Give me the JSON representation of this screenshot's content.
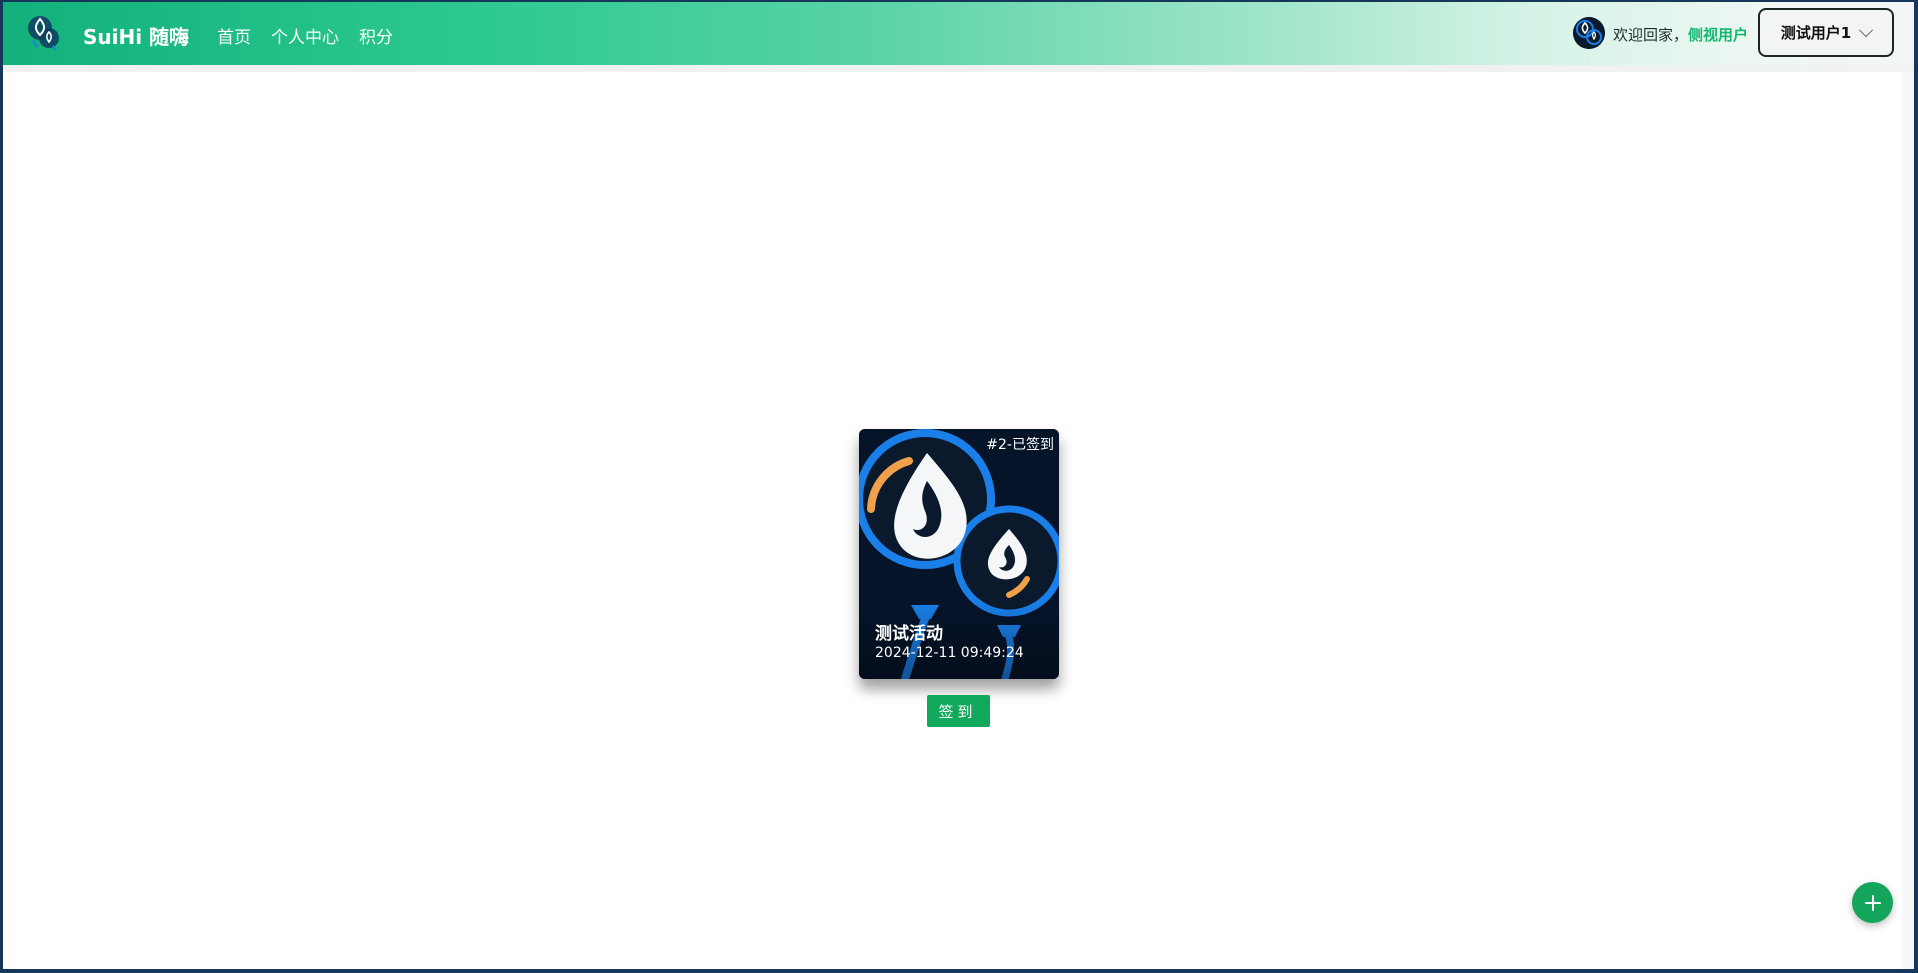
{
  "header": {
    "brand": "SuiHi 随嗨",
    "nav": [
      {
        "label": "首页"
      },
      {
        "label": "个人中心"
      },
      {
        "label": "积分"
      }
    ],
    "welcome_prefix": "欢迎回家，",
    "welcome_role": "侧视用户",
    "account_name": "测试用户1"
  },
  "card": {
    "badge": "#2-已签到",
    "title": "测试活动",
    "time": "2024-12-11 09:49:24"
  },
  "checkin_label": "签到",
  "colors": {
    "brand_green": "#12b17b",
    "accent_green": "#14b86f",
    "button_green": "#12a95d",
    "card_bg": "#06142a",
    "balloon_blue": "#1a7fe8",
    "orange_accent": "#f0a04b"
  },
  "icons": {
    "logo": "sui-drop-logo-icon",
    "avatar": "sui-avatar-icon",
    "dropdown": "chevron-down-icon",
    "fab": "plus-icon"
  }
}
